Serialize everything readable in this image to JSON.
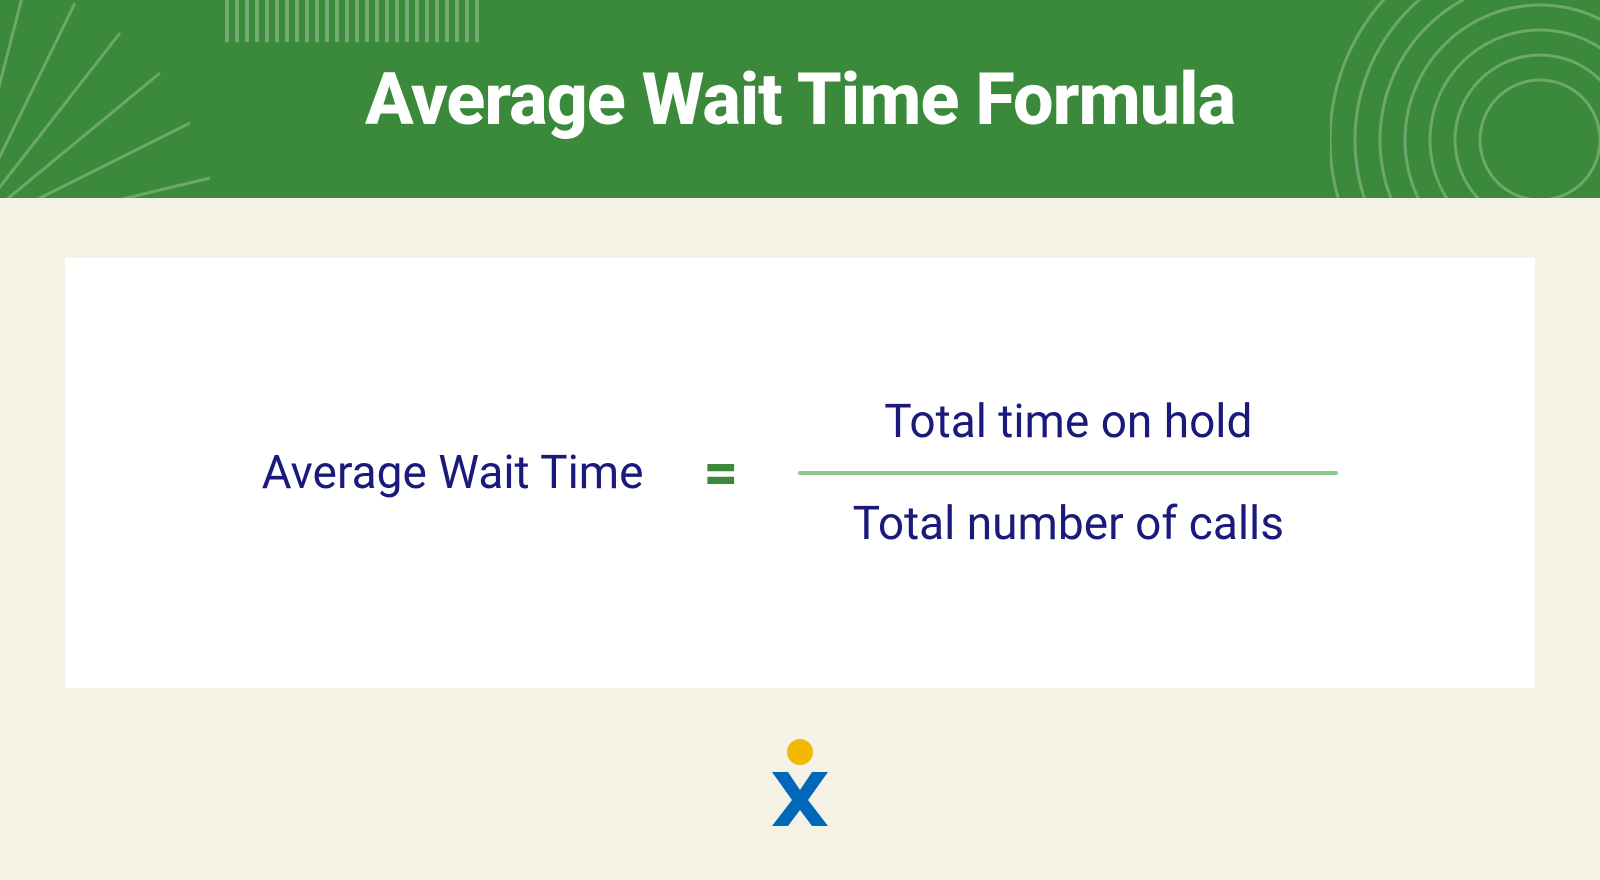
{
  "header": {
    "title": "Average Wait Time Formula"
  },
  "formula": {
    "lhs": "Average Wait Time",
    "equals": "=",
    "numerator": "Total time on hold",
    "denominator": "Total number of calls"
  },
  "colors": {
    "header_bg": "#3b8a3b",
    "page_bg": "#f4f1e5",
    "card_bg": "#ffffff",
    "text_navy": "#1a1a7a",
    "accent_green": "#3b8a3b",
    "divider_green": "#8cc98c",
    "logo_yellow": "#f5b800",
    "logo_blue": "#0067b9"
  },
  "logo": {
    "name": "nextiva-logo"
  }
}
